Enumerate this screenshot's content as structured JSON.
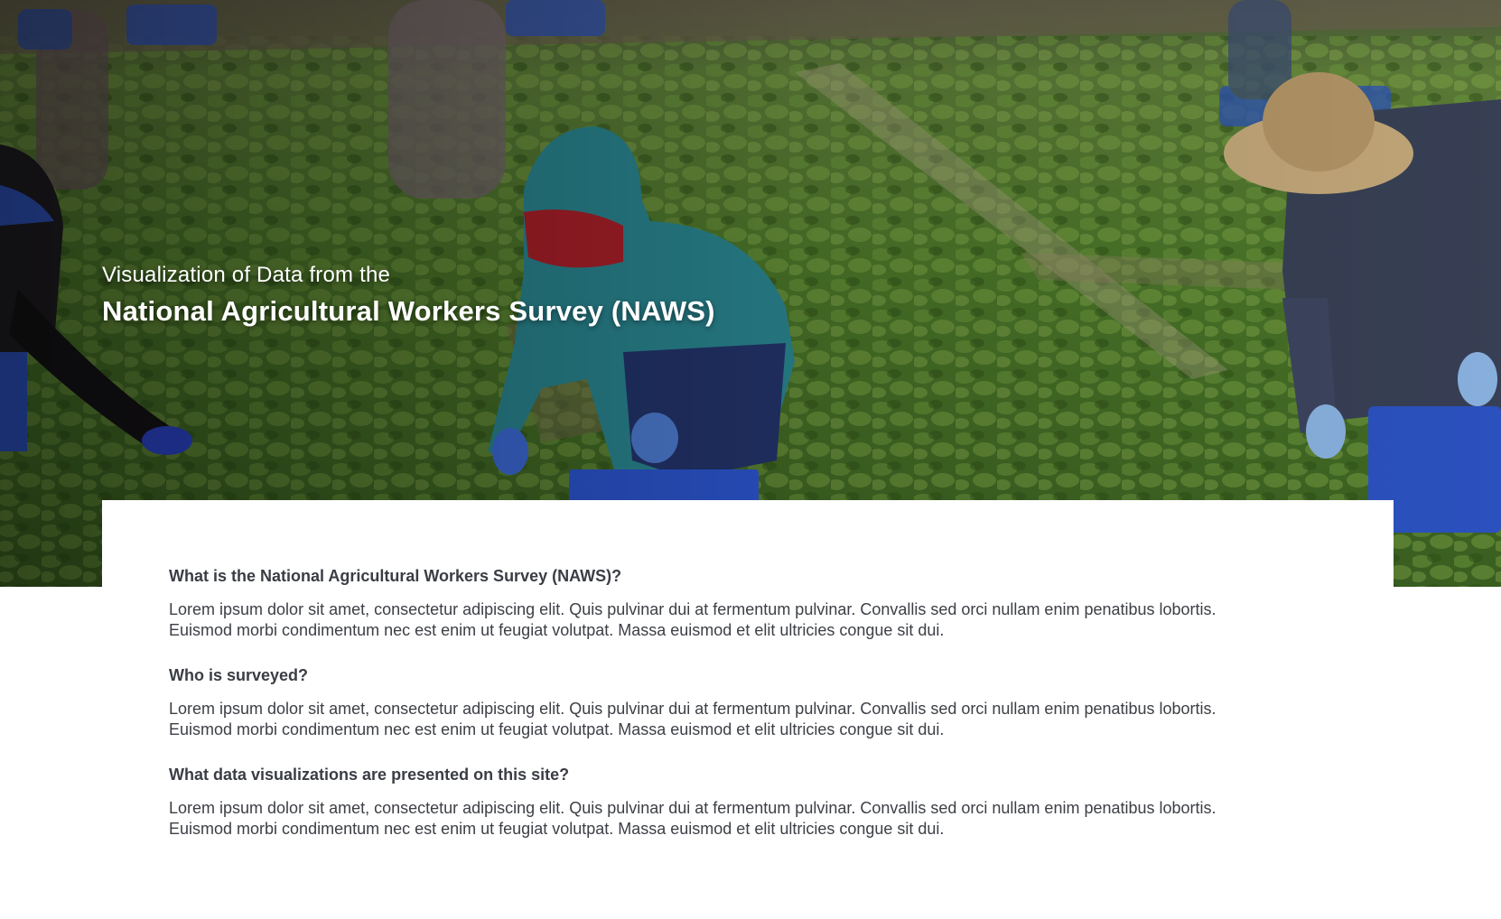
{
  "hero": {
    "subtitle": "Visualization of Data from the",
    "title": "National Agricultural Workers Survey (NAWS)",
    "image": "photo of farm workers harvesting in a green crop field"
  },
  "faq": [
    {
      "question": "What is the National Agricultural Workers Survey (NAWS)?",
      "answer_line1": "Lorem ipsum dolor sit amet, consectetur adipiscing elit. Quis pulvinar dui at fermentum pulvinar. Convallis sed orci nullam enim penatibus lobortis.",
      "answer_line2": "Euismod morbi condimentum nec est enim ut feugiat volutpat. Massa euismod et elit ultricies congue sit dui."
    },
    {
      "question": "Who is surveyed?",
      "answer_line1": "Lorem ipsum dolor sit amet, consectetur adipiscing elit. Quis pulvinar dui at fermentum pulvinar. Convallis sed orci nullam enim penatibus lobortis.",
      "answer_line2": "Euismod morbi condimentum nec est enim ut feugiat volutpat. Massa euismod et elit ultricies congue sit dui."
    },
    {
      "question": "What data visualizations are presented on this site?",
      "answer_line1": "Lorem ipsum dolor sit amet, consectetur adipiscing elit. Quis pulvinar dui at fermentum pulvinar. Convallis sed orci nullam enim penatibus lobortis.",
      "answer_line2": "Euismod morbi condimentum nec est enim ut feugiat volutpat. Massa euismod et elit ultricies congue sit dui."
    }
  ],
  "colors": {
    "hero_overlay": "#1a2a12",
    "text": "#3c3f45",
    "heading": "#3a3d44",
    "background": "#ffffff"
  }
}
